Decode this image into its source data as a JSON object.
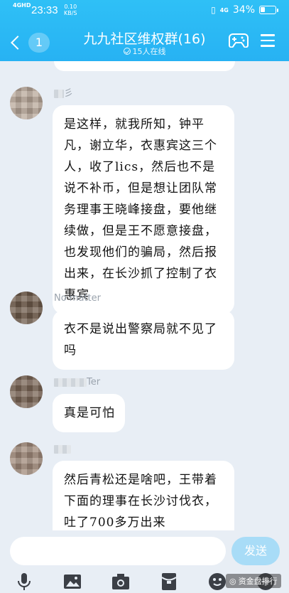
{
  "status_bar": {
    "signal": "4GHD",
    "time": "23:33",
    "speed_value": "0.10",
    "speed_unit": "KB/S",
    "network": "4G",
    "battery_text": "34%",
    "battery_level": 0.34
  },
  "header": {
    "back_badge": "1",
    "title": "九九社区维权群(16)",
    "subtitle": "15人在线"
  },
  "messages": [
    {
      "sender": "彡",
      "text": "是这样，就我所知，钟平凡，谢立华，衣惠宾这三个人，收了lics，然后也不是说不补币，但是想让团队常务理事王晓峰接盘，要他继续做，但是王不愿意接盘，也发现他们的骗局，然后报出来，在长沙抓了控制了衣惠宾"
    },
    {
      "sender": "No matter",
      "text": "衣不是说出警察局就不见了吗"
    },
    {
      "sender": "Ter",
      "text": "真是可怕"
    },
    {
      "sender": "",
      "text": "然后青松还是啥吧，王带着下面的理事在长沙讨伐衣，吐了700多万出来"
    }
  ],
  "input": {
    "placeholder": "",
    "send_label": "发送"
  },
  "toolbar": {
    "icons": [
      "mic-icon",
      "image-icon",
      "camera-icon",
      "red-packet-icon",
      "emoji-icon",
      "plus-icon"
    ]
  },
  "watermark": {
    "text": "资金盘排行"
  },
  "colors": {
    "header": "#2fc0f6",
    "background": "#e8eef5",
    "send_button": "#a8dcf7"
  }
}
